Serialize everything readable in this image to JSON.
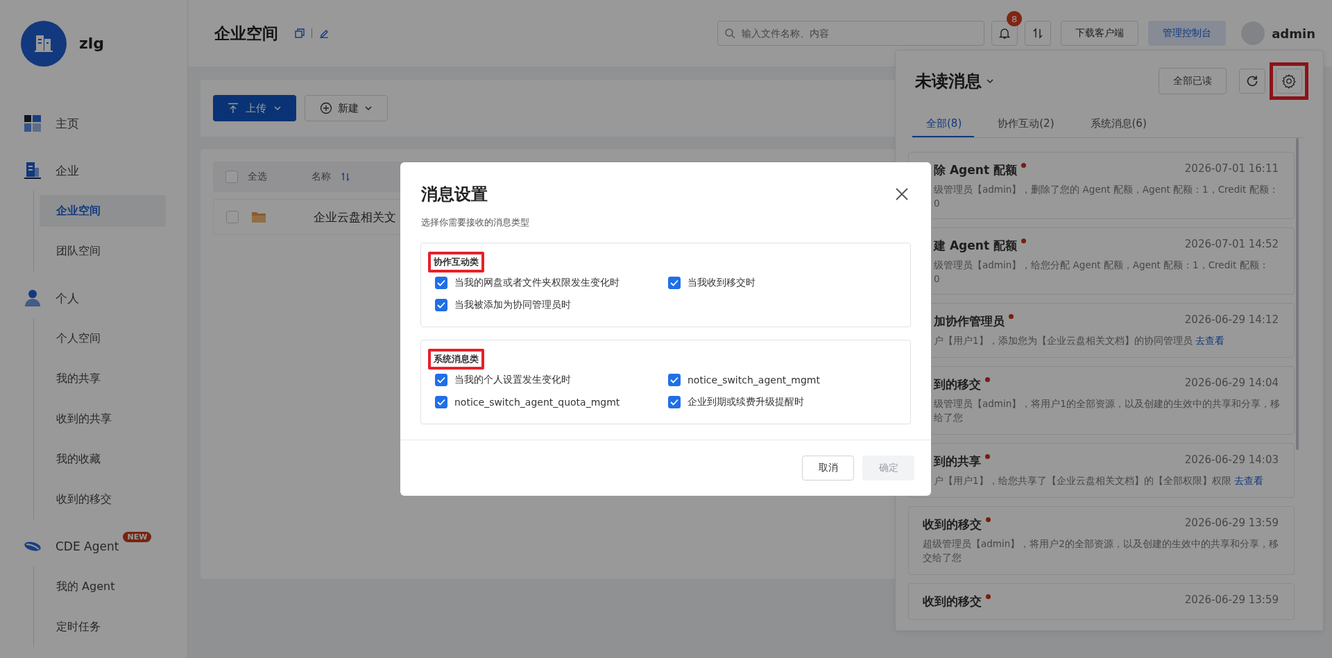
{
  "sidebar": {
    "org_name": "zlg",
    "sections": [
      {
        "label": "主页",
        "selected": false
      },
      {
        "label": "企业",
        "selected": false,
        "children": [
          {
            "label": "企业空间",
            "selected": true
          },
          {
            "label": "团队空间",
            "selected": false
          }
        ]
      },
      {
        "label": "个人",
        "selected": false,
        "children": [
          {
            "label": "个人空间",
            "selected": false
          },
          {
            "label": "我的共享",
            "selected": false
          },
          {
            "label": "收到的共享",
            "selected": false
          },
          {
            "label": "我的收藏",
            "selected": false
          },
          {
            "label": "收到的移交",
            "selected": false
          }
        ]
      },
      {
        "label": "CDE Agent",
        "selected": false,
        "badge": "NEW",
        "children": [
          {
            "label": "我的 Agent",
            "selected": false
          },
          {
            "label": "定时任务",
            "selected": false
          }
        ]
      }
    ]
  },
  "header": {
    "title": "企业空间",
    "search": {
      "placeholder": "输入文件名称、内容"
    },
    "notification_count": "8",
    "buttons": [
      {
        "label": "下载客户端",
        "kind": "default"
      },
      {
        "label": "管理控制台",
        "kind": "primary"
      }
    ],
    "user": "admin"
  },
  "toolbar": {
    "upload": "上传",
    "create": "新建"
  },
  "table": {
    "select_all": {
      "label": "全选",
      "checked": false
    },
    "columns": [
      "名称"
    ],
    "rows": [
      {
        "name": "企业云盘相关文",
        "checked": false
      }
    ]
  },
  "panel": {
    "title": "未读消息",
    "mark_all": "全部已读",
    "settings_highlighted": true,
    "tabs": [
      {
        "label": "全部(8)",
        "selected": true
      },
      {
        "label": "协作互动(2)",
        "selected": false
      },
      {
        "label": "系统消息(6)",
        "selected": false
      }
    ],
    "messages": [
      {
        "title": "除 Agent 配额",
        "unread": true,
        "time": "2026-07-01 16:11",
        "cut_off": true,
        "lines": [
          "级管理员【admin】，删除了您的 Agent 配额，Agent 配额：1，Credit 配额：",
          "0"
        ]
      },
      {
        "title": "建 Agent 配额",
        "unread": true,
        "time": "2026-07-01 14:52",
        "cut_off": true,
        "lines": [
          "级管理员【admin】，给您分配 Agent 配额，Agent 配额：1，Credit 配额：",
          "0"
        ]
      },
      {
        "title": "加协作管理员",
        "unread": true,
        "time": "2026-06-29 14:12",
        "cut_off": true,
        "lines": [
          "户【用户1】，添加您为【企业云盘相关文档】的协同管理员"
        ],
        "link": "去查看"
      },
      {
        "title": "到的移交",
        "unread": true,
        "time": "2026-06-29 14:04",
        "cut_off": true,
        "lines": [
          "级管理员【admin】，将用户1的全部资源，以及创建的生效中的共享和分享，移",
          "给了您"
        ]
      },
      {
        "title": "到的共享",
        "unread": true,
        "time": "2026-06-29 14:03",
        "cut_off": true,
        "lines": [
          "户【用户1】，给您共享了【企业云盘相关文档】的【全部权限】权限"
        ],
        "link": "去查看"
      },
      {
        "title": "收到的移交",
        "unread": true,
        "time": "2026-06-29 13:59",
        "cut_off": false,
        "lines": [
          "超级管理员【admin】，将用户2的全部资源，以及创建的生效中的共享和分享，移",
          "交给了您"
        ]
      },
      {
        "title": "收到的移交",
        "unread": true,
        "time": "2026-06-29 13:59",
        "cut_off": false
      }
    ]
  },
  "modal": {
    "title": "消息设置",
    "subtitle": "选择你需要接收的消息类型",
    "sections": [
      {
        "title": "协作互动类",
        "highlighted": true,
        "options": [
          {
            "label": "当我的网盘或者文件夹权限发生变化时",
            "checked": true
          },
          {
            "label": "当我收到移交时",
            "checked": true
          },
          {
            "label": "当我被添加为协同管理员时",
            "checked": true
          }
        ]
      },
      {
        "title": "系统消息类",
        "highlighted": true,
        "options": [
          {
            "label": "当我的个人设置发生变化时",
            "checked": true
          },
          {
            "label": "notice_switch_agent_mgmt",
            "checked": true
          },
          {
            "label": "notice_switch_agent_quota_mgmt",
            "checked": true
          },
          {
            "label": "企业到期或续费升级提醒时",
            "checked": true
          }
        ]
      }
    ],
    "buttons": [
      {
        "label": "取消",
        "kind": "secondary",
        "disabled": false
      },
      {
        "label": "确定",
        "kind": "primary",
        "disabled": true
      }
    ]
  }
}
